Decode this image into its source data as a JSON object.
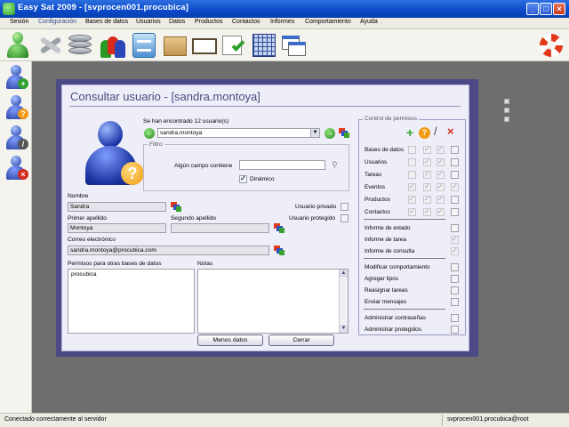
{
  "window": {
    "title": "Easy Sat 2009 - [svprocen001.procubica]"
  },
  "menu": [
    "Sesión",
    "Configuración",
    "Bases de datos",
    "Usuarios",
    "Datos",
    "Productos",
    "Contactos",
    "Informes",
    "Comportamiento",
    "Ayuda"
  ],
  "toolbar": {
    "icons": [
      "user-icon",
      "tools-icon",
      "database-icon",
      "users-icon",
      "cabinet-icon",
      "box-icon",
      "book-icon",
      "checklist-icon",
      "grid-icon",
      "windows-icon",
      "help-lifebuoy-icon"
    ]
  },
  "sidebar": {
    "icons": [
      "add-user-icon",
      "query-user-icon",
      "edit-user-icon",
      "delete-user-icon"
    ]
  },
  "dialog": {
    "title": "Consultar usuario - [sandra.montoya]",
    "found_label": "Se han encontrado 12 usuario(s)",
    "selected_user": "sandra.montoya",
    "filter": {
      "legend": "Filtro",
      "search_label": "Algún campo contiene",
      "search_value": "",
      "dynamic_label": "Dinámico",
      "dynamic_checked": true
    },
    "nombre_label": "Nombre",
    "nombre_value": "Sandra",
    "primer_apellido_label": "Primer apellido",
    "primer_apellido_value": "Montoya",
    "segundo_apellido_label": "Segundo apellido",
    "segundo_apellido_value": "",
    "correo_label": "Correo electrónico",
    "correo_value": "sandra.montoya@procubica.com",
    "usuario_privado_label": "Usuario privado",
    "usuario_protegido_label": "Usuario protegido",
    "permisos_label": "Permisos para otras bases de datos",
    "permisos_items": [
      "procubica"
    ],
    "notas_label": "Notas",
    "notas_value": "",
    "btn_menos": "Menos datos",
    "btn_cerrar": "Cerrar",
    "perm_control": {
      "legend": "Control de permisos",
      "grid_rows": [
        {
          "label": "Bases de datos",
          "checks": [
            false,
            true,
            true,
            false
          ]
        },
        {
          "label": "Usuarios",
          "checks": [
            false,
            true,
            true,
            false
          ]
        },
        {
          "label": "Tareas",
          "checks": [
            false,
            true,
            true,
            false
          ]
        },
        {
          "label": "Eventos",
          "checks": [
            true,
            true,
            true,
            true
          ]
        },
        {
          "label": "Productos",
          "checks": [
            true,
            true,
            true,
            false
          ]
        },
        {
          "label": "Contactos",
          "checks": [
            true,
            true,
            true,
            false
          ]
        }
      ],
      "informes": [
        {
          "label": "Informe de estado",
          "checked": false
        },
        {
          "label": "Informe de tarea",
          "checked": true
        },
        {
          "label": "Informe de consulta",
          "checked": true
        }
      ],
      "comportamiento": [
        {
          "label": "Modificar comportamiento",
          "checked": false
        },
        {
          "label": "Agregar tipos",
          "checked": false
        },
        {
          "label": "Reasignar tareas",
          "checked": false
        },
        {
          "label": "Enviar mensajes",
          "checked": false
        }
      ],
      "admin": [
        {
          "label": "Administrar contraseñas",
          "checked": false
        },
        {
          "label": "Administrar protegidos",
          "checked": false
        }
      ]
    }
  },
  "status": {
    "left": "Conectado correctamente al servidor",
    "right": "svprocen001.procubica@root"
  }
}
